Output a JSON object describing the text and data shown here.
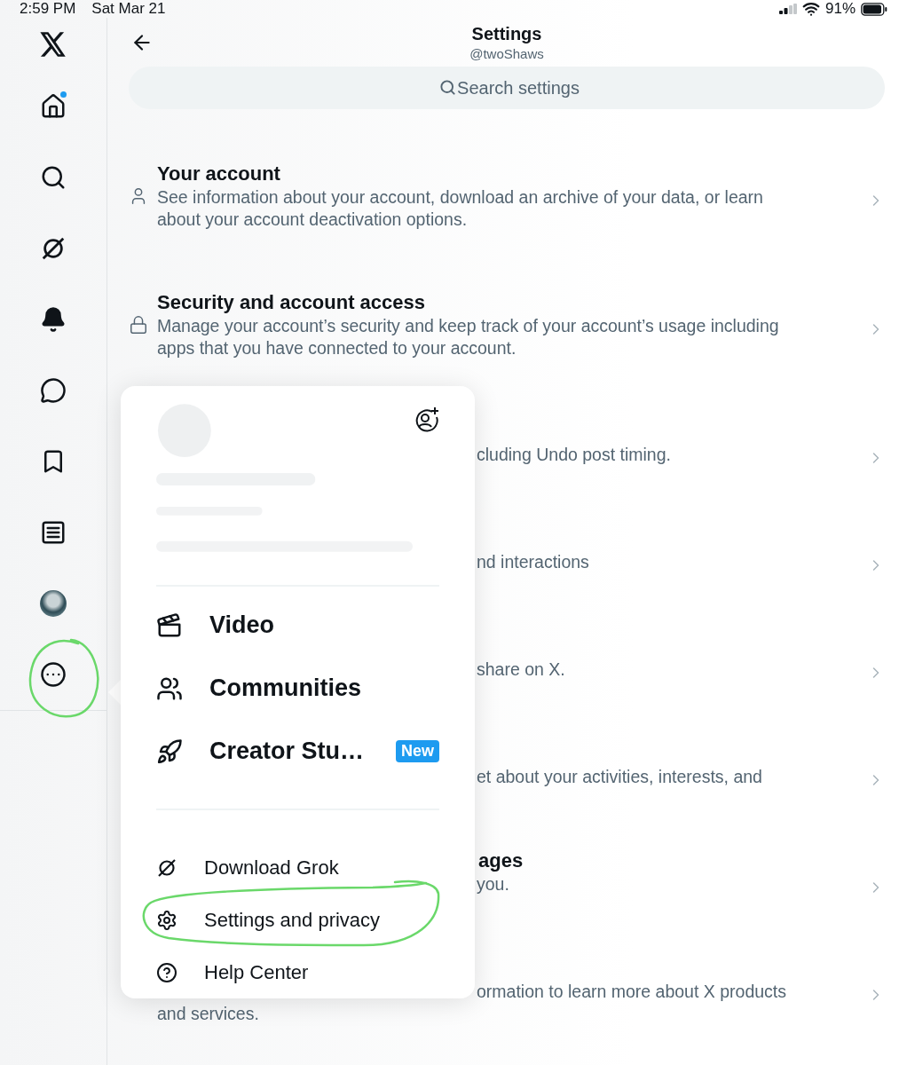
{
  "status_bar": {
    "time": "2:59 PM",
    "date": "Sat Mar 21",
    "battery": "91%"
  },
  "sidebar": {
    "items": [
      {
        "kind": "logo",
        "badge": false,
        "circled": false
      },
      {
        "kind": "home",
        "badge": true,
        "circled": false
      },
      {
        "kind": "search",
        "badge": false,
        "circled": false
      },
      {
        "kind": "grok",
        "badge": false,
        "circled": false
      },
      {
        "kind": "notifications",
        "badge": false,
        "circled": false
      },
      {
        "kind": "messages",
        "badge": false,
        "circled": false
      },
      {
        "kind": "bookmarks",
        "badge": false,
        "circled": false
      },
      {
        "kind": "lists",
        "badge": false,
        "circled": false
      },
      {
        "kind": "profile",
        "badge": false,
        "circled": false
      },
      {
        "kind": "more",
        "badge": false,
        "circled": true
      }
    ]
  },
  "header": {
    "title": "Settings",
    "subtitle": "@twoShaws"
  },
  "search": {
    "placeholder": "Search settings"
  },
  "settings": [
    {
      "title": "Your account",
      "lines": [
        "See information about your account, download an archive of your data, or learn",
        "about your account deactivation options."
      ]
    },
    {
      "title": "Security and account access",
      "lines": [
        "Manage your account’s security and keep track of your account’s usage including",
        "apps that you have connected to your account."
      ]
    },
    {
      "lines": [
        "cluding Undo post timing."
      ]
    },
    {
      "lines": [
        "nd interactions"
      ]
    },
    {
      "lines": [
        "share on X."
      ]
    },
    {
      "lines": [
        "et about your activities, interests, and"
      ]
    },
    {
      "title": "ages",
      "lines": [
        "you."
      ]
    },
    {
      "lines": [
        "ormation to learn more about X products",
        "and services."
      ]
    }
  ],
  "menu": {
    "items": [
      {
        "kind": "primary",
        "label": "Video",
        "circled": false
      },
      {
        "kind": "primary",
        "label": "Communities",
        "circled": false
      },
      {
        "kind": "primary",
        "label": "Creator Stu…",
        "badge": "New",
        "circled": false
      },
      {
        "kind": "secondary",
        "label": "Download Grok",
        "circled": false
      },
      {
        "kind": "secondary",
        "label": "Settings and privacy",
        "circled": true
      },
      {
        "kind": "secondary",
        "label": "Help Center",
        "circled": false
      }
    ]
  }
}
